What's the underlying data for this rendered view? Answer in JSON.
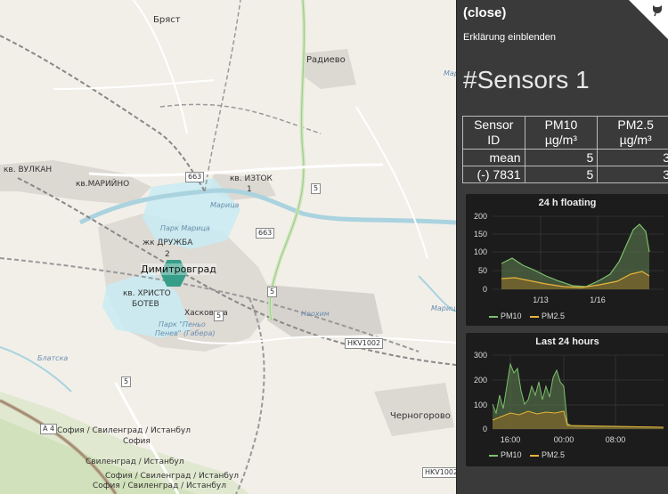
{
  "map": {
    "labels": {
      "briast": "Бряст",
      "radievo": "Радиево",
      "vulkan": "кв. ВУЛКАН",
      "mariyno": "кв.МАРИЙНО",
      "iztok": "кв. ИЗТОК",
      "iztok_n": "1",
      "druzhba": "жк ДРУЖБА",
      "druzhba_n": "2",
      "dimitrovgrad": "Димитровград",
      "hristo": "кв. ХРИСТО",
      "botev": "БОТЕВ",
      "park_maritsa": "Парк Марица",
      "park_penyo": "Парк \"Пеньо",
      "park_penyo2": "Пенев\" (Габера)",
      "haskovska": "Хасковска",
      "neohim": "Неохим",
      "chernogorovo": "Черногорово",
      "maritsa": "Марица",
      "maritsa2": "Марица",
      "maritsa3": "Марица",
      "blatsa": "Блатска",
      "sofia1": "София / Свиленград / Истанбул",
      "sofia2": "София",
      "svilen1": "Свиленград / Истанбул",
      "sofia3": "София / Свиленград / Истанбул",
      "sofia4": "София / Свиленград / Истанбул"
    },
    "shields": {
      "r663a": "663",
      "r663b": "663",
      "r5a": "5",
      "r5b": "5",
      "r5c": "5",
      "r5d": "5",
      "hkv1": "HKV1002",
      "hkv2": "HKV1002",
      "a4": "A 4"
    }
  },
  "sidebar": {
    "close_label": "(close)",
    "explain_label": "Erklärung einblenden",
    "title": "#Sensors 1",
    "table": {
      "headers": [
        "Sensor ID",
        "PM10 µg/m³",
        "PM2.5 µg/m³"
      ],
      "rows": [
        [
          "mean",
          "5",
          "3"
        ],
        [
          "(-) 7831",
          "5",
          "3"
        ]
      ]
    }
  },
  "charts": [
    {
      "title": "24 h floating",
      "ymax": 200,
      "yticks": [
        "200",
        "150",
        "100",
        "50",
        "0"
      ],
      "xticks": [
        "1/13",
        "1/16"
      ],
      "legend": [
        "PM10",
        "PM2.5"
      ]
    },
    {
      "title": "Last 24 hours",
      "ymax": 300,
      "yticks": [
        "300",
        "200",
        "100",
        "0"
      ],
      "xticks": [
        "16:00",
        "00:00",
        "08:00"
      ],
      "legend": [
        "PM10",
        "PM2.5"
      ]
    }
  ],
  "colors": {
    "pm10": "#7cc06d",
    "pm25": "#e9b43a",
    "sidebar": "#3a3a3a",
    "hex": "#2d9b85"
  }
}
